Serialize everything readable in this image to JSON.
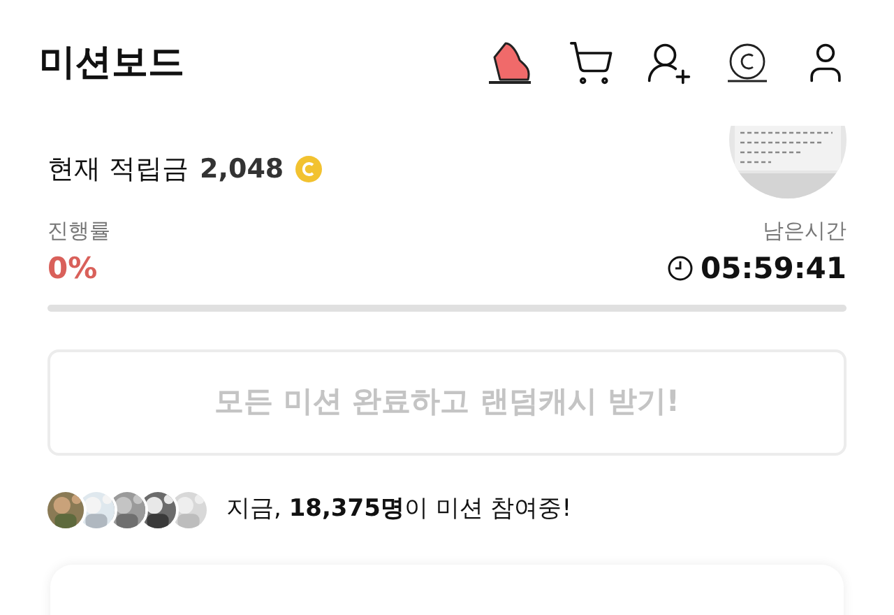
{
  "header": {
    "title": "미션보드"
  },
  "balance": {
    "label": "현재 적립금",
    "amount": "2,048"
  },
  "progress": {
    "label": "진행률",
    "value": "0%",
    "level": 0
  },
  "time_left": {
    "label": "남은시간",
    "value": "05:59:41"
  },
  "reward_button": {
    "label": "모든 미션 완료하고 랜덤캐시 받기!",
    "disabled": true
  },
  "participants": {
    "text": "지금, **18,375명**이 미션 참여중!"
  }
}
